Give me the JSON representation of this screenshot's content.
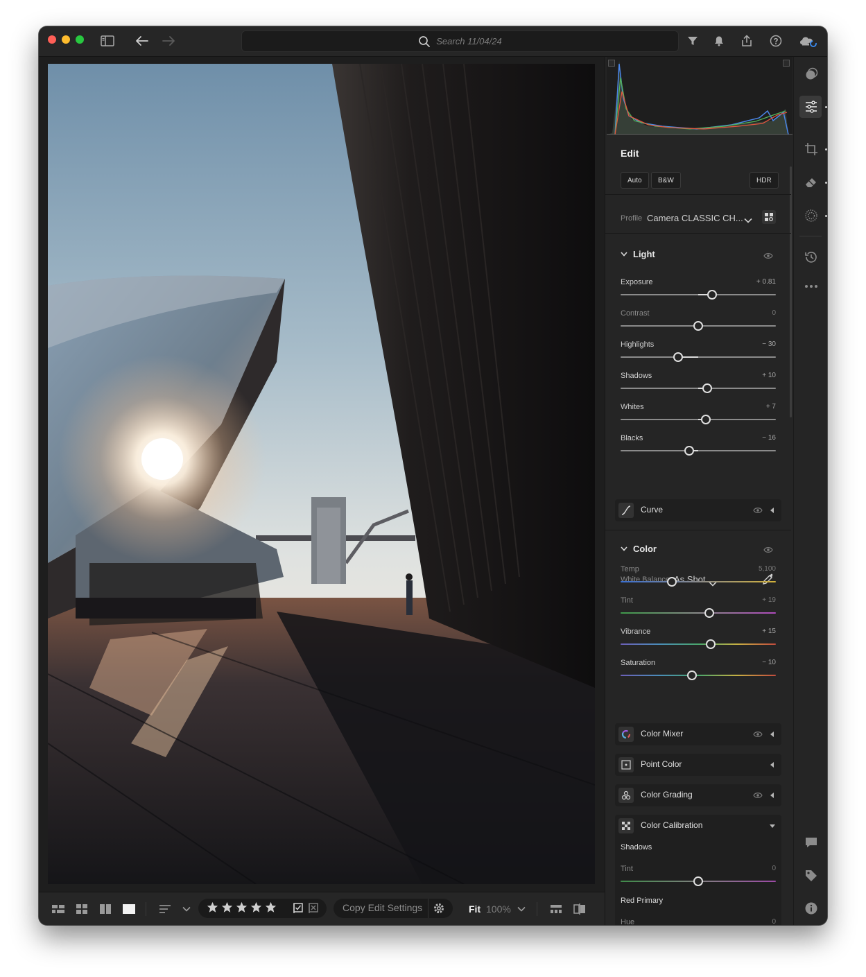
{
  "titlebar": {
    "search_placeholder": "Search 11/04/24"
  },
  "edit_panel": {
    "title": "Edit",
    "buttons": [
      "Auto",
      "B&W",
      "HDR"
    ],
    "profile_label": "Profile",
    "profile_value": "Camera CLASSIC CH..."
  },
  "light": {
    "title": "Light",
    "sliders": [
      {
        "name": "Exposure",
        "value": "+ 0.81",
        "position": 0.59,
        "active": true
      },
      {
        "name": "Contrast",
        "value": "0",
        "position": 0.5,
        "active": false
      },
      {
        "name": "Highlights",
        "value": "− 30",
        "position": 0.37,
        "active": true
      },
      {
        "name": "Shadows",
        "value": "+ 10",
        "position": 0.56,
        "active": true
      },
      {
        "name": "Whites",
        "value": "+ 7",
        "position": 0.55,
        "active": true
      },
      {
        "name": "Blacks",
        "value": "− 16",
        "position": 0.44,
        "active": true
      }
    ]
  },
  "curve_label": "Curve",
  "color": {
    "title": "Color",
    "wb_label": "White Balance",
    "wb_value": "As Shot",
    "sliders": [
      {
        "name": "Temp",
        "value": "5,100",
        "position": 0.33,
        "active": false
      },
      {
        "name": "Tint",
        "value": "+ 19",
        "position": 0.57,
        "active": false
      },
      {
        "name": "Vibrance",
        "value": "+ 15",
        "position": 0.58,
        "active": true
      },
      {
        "name": "Saturation",
        "value": "− 10",
        "position": 0.46,
        "active": true
      }
    ]
  },
  "subpanels": {
    "color_mixer": "Color Mixer",
    "point_color": "Point Color",
    "color_grading": "Color Grading",
    "color_calibration": "Color Calibration"
  },
  "calibration": {
    "shadows_label": "Shadows",
    "shadows_tint_name": "Tint",
    "shadows_tint_value": "0",
    "red_primary_label": "Red Primary",
    "red_hue_name": "Hue",
    "red_hue_value": "0"
  },
  "bottombar": {
    "copy_edit_settings": "Copy Edit Settings",
    "fit_label": "Fit",
    "zoom_label": "100%",
    "star_rating": 0
  },
  "colors": {
    "accent_cloud": "#3a8df5",
    "window_bg": "#1e1e1e",
    "panel_bg": "#252525"
  }
}
